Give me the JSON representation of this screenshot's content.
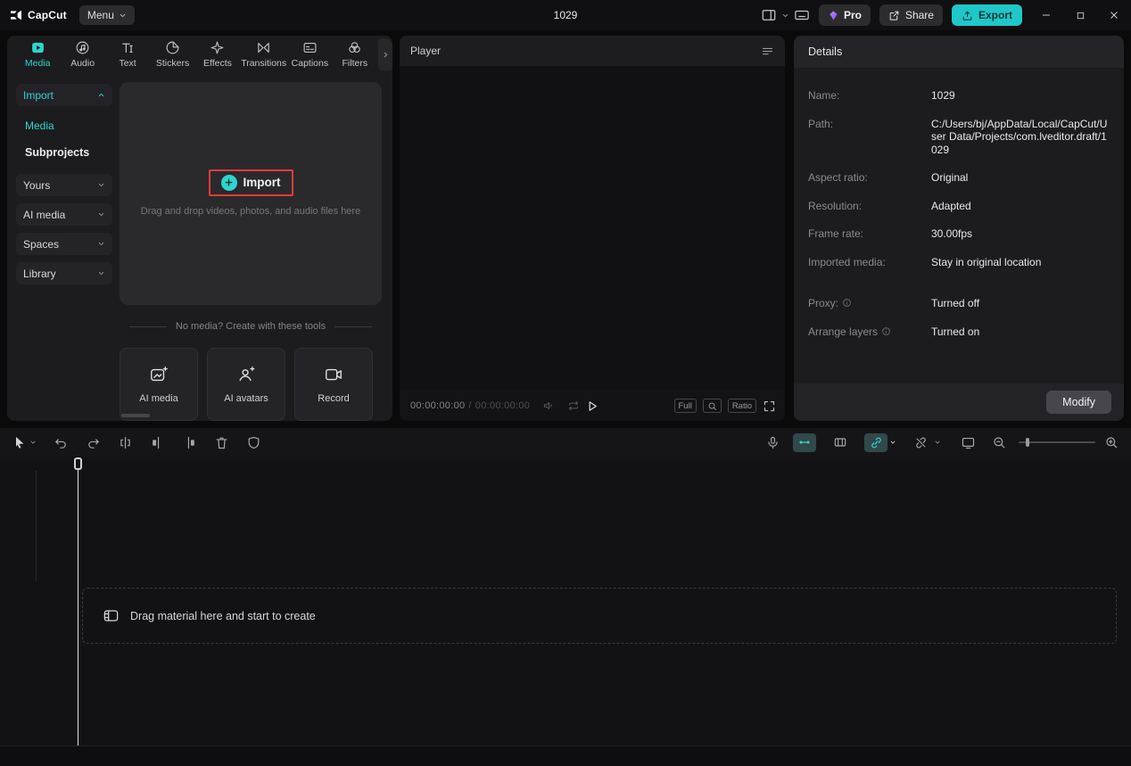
{
  "colors": {
    "accent": "#2fd4ce",
    "export_teal": "#1ec8c9",
    "pro_purple": "#9a5cf7",
    "highlight_red": "#e23b3b"
  },
  "titlebar": {
    "app_name": "CapCut",
    "menu_label": "Menu",
    "project_title": "1029",
    "pro_label": "Pro",
    "share_label": "Share",
    "export_label": "Export"
  },
  "media_panel": {
    "tabs": [
      {
        "label": "Media"
      },
      {
        "label": "Audio"
      },
      {
        "label": "Text"
      },
      {
        "label": "Stickers"
      },
      {
        "label": "Effects"
      },
      {
        "label": "Transitions"
      },
      {
        "label": "Captions"
      },
      {
        "label": "Filters"
      }
    ],
    "active_tab": "Media",
    "sidebar": {
      "import_label": "Import",
      "media_label": "Media",
      "subprojects_label": "Subprojects",
      "groups": [
        {
          "label": "Yours"
        },
        {
          "label": "AI media"
        },
        {
          "label": "Spaces"
        },
        {
          "label": "Library"
        }
      ]
    },
    "dropzone": {
      "import_button": "Import",
      "hint_line": "Drag and drop videos, photos, and audio files here"
    },
    "tools_divider": "No media? Create with these tools",
    "tools": [
      {
        "label": "AI media"
      },
      {
        "label": "AI avatars"
      },
      {
        "label": "Record"
      }
    ]
  },
  "player": {
    "title": "Player",
    "timecode_current": "00:00:00:00",
    "timecode_separator": "/",
    "timecode_total": "00:00:00:00",
    "full_label": "Full",
    "ratio_label": "Ratio"
  },
  "details": {
    "title": "Details",
    "rows": [
      {
        "label": "Name:",
        "value": "1029"
      },
      {
        "label": "Path:",
        "value": "C:/Users/bj/AppData/Local/CapCut/User Data/Projects/com.lveditor.draft/1029"
      },
      {
        "label": "Aspect ratio:",
        "value": "Original"
      },
      {
        "label": "Resolution:",
        "value": "Adapted"
      },
      {
        "label": "Frame rate:",
        "value": "30.00fps"
      },
      {
        "label": "Imported media:",
        "value": "Stay in original location"
      },
      {
        "label": "Proxy:",
        "value": "Turned off"
      },
      {
        "label": "Arrange layers",
        "value": "Turned on"
      }
    ],
    "modify_label": "Modify"
  },
  "timeline": {
    "dropzone_text": "Drag material here and start to create"
  }
}
